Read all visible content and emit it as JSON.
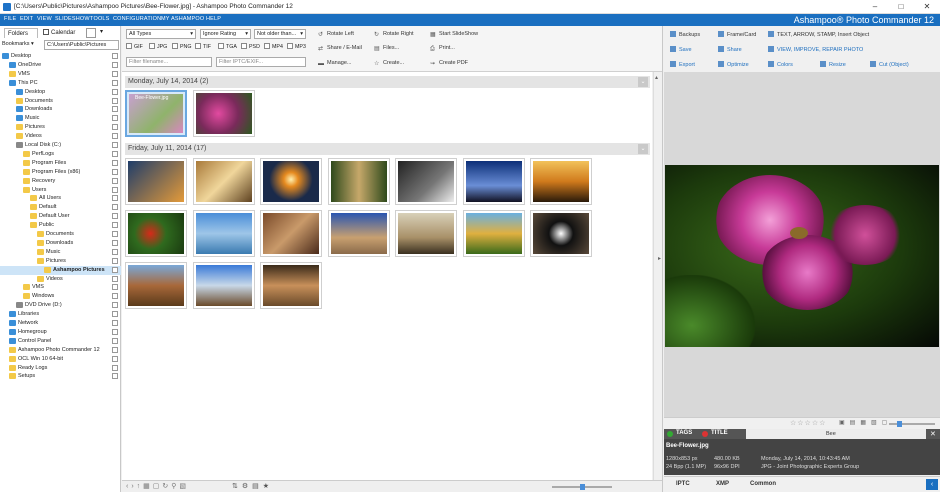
{
  "window": {
    "title": "[C:\\Users\\Public\\Pictures\\Ashampoo Pictures\\Bee-Flower.jpg] - Ashampoo Photo Commander 12",
    "brand": "Ashampoo® Photo Commander 12"
  },
  "menu": [
    "FILE",
    "EDIT",
    "VIEW",
    "SLIDESHOW",
    "TOOLS",
    "CONFIGURATION",
    "MY ASHAMPOO",
    "HELP"
  ],
  "left": {
    "tabs": {
      "folders": "Folders",
      "calendar": "Calendar"
    },
    "bookmarks": "Bookmarks",
    "path": "C:\\Users\\Public\\Pictures",
    "tree": [
      {
        "label": "Desktop",
        "indent": 0,
        "color": "#3a8fd8"
      },
      {
        "label": "OneDrive",
        "indent": 1,
        "color": "#3a8fd8"
      },
      {
        "label": "VMS",
        "indent": 1,
        "color": "#f3c948"
      },
      {
        "label": "This PC",
        "indent": 1,
        "color": "#3a8fd8"
      },
      {
        "label": "Desktop",
        "indent": 2,
        "color": "#3a8fd8"
      },
      {
        "label": "Documents",
        "indent": 2,
        "color": "#f3c948"
      },
      {
        "label": "Downloads",
        "indent": 2,
        "color": "#3a8fd8"
      },
      {
        "label": "Music",
        "indent": 2,
        "color": "#3a8fd8"
      },
      {
        "label": "Pictures",
        "indent": 2,
        "color": "#f3c948"
      },
      {
        "label": "Videos",
        "indent": 2,
        "color": "#f3c948"
      },
      {
        "label": "Local Disk (C:)",
        "indent": 2,
        "color": "#888888"
      },
      {
        "label": "PerfLogs",
        "indent": 3,
        "color": "#f3c948"
      },
      {
        "label": "Program Files",
        "indent": 3,
        "color": "#f3c948"
      },
      {
        "label": "Program Files (x86)",
        "indent": 3,
        "color": "#f3c948"
      },
      {
        "label": "Recovery",
        "indent": 3,
        "color": "#f3c948"
      },
      {
        "label": "Users",
        "indent": 3,
        "color": "#f3c948"
      },
      {
        "label": "All Users",
        "indent": 4,
        "color": "#f3c948"
      },
      {
        "label": "Default",
        "indent": 4,
        "color": "#f3c948"
      },
      {
        "label": "Default User",
        "indent": 4,
        "color": "#f3c948"
      },
      {
        "label": "Public",
        "indent": 4,
        "color": "#f3c948"
      },
      {
        "label": "Documents",
        "indent": 5,
        "color": "#f3c948"
      },
      {
        "label": "Downloads",
        "indent": 5,
        "color": "#f3c948"
      },
      {
        "label": "Music",
        "indent": 5,
        "color": "#f3c948"
      },
      {
        "label": "Pictures",
        "indent": 5,
        "color": "#f3c948"
      },
      {
        "label": "Ashampoo Pictures",
        "indent": 6,
        "color": "#f3c948",
        "selected": true
      },
      {
        "label": "Videos",
        "indent": 5,
        "color": "#f3c948"
      },
      {
        "label": "VMS",
        "indent": 3,
        "color": "#f3c948"
      },
      {
        "label": "Windows",
        "indent": 3,
        "color": "#f3c948"
      },
      {
        "label": "DVD Drive (D:)",
        "indent": 2,
        "color": "#888888"
      },
      {
        "label": "Libraries",
        "indent": 1,
        "color": "#3a8fd8"
      },
      {
        "label": "Network",
        "indent": 1,
        "color": "#3a8fd8"
      },
      {
        "label": "Homegroup",
        "indent": 1,
        "color": "#3a8fd8"
      },
      {
        "label": "Control Panel",
        "indent": 1,
        "color": "#3a8fd8"
      },
      {
        "label": "Ashampoo Photo Commander 12",
        "indent": 1,
        "color": "#f3c948"
      },
      {
        "label": "OCL Win 10 64-bit",
        "indent": 1,
        "color": "#f3c948"
      },
      {
        "label": "Ready Logs",
        "indent": 1,
        "color": "#f3c948"
      },
      {
        "label": "Setups",
        "indent": 1,
        "color": "#f3c948"
      }
    ]
  },
  "filters": {
    "type": "All Types",
    "rating": "Ignore Rating",
    "age": "Not older than...",
    "formats": [
      "GIF",
      "JPG",
      "PNG",
      "TIF",
      "TGA",
      "PSD",
      "MP4",
      "MP3"
    ],
    "filename_ph": "Filter filename...",
    "iptc_ph": "Filter IPTC/EXIF..."
  },
  "actions": {
    "rotate_left": "Rotate Left",
    "rotate_right": "Rotate Right",
    "slideshow": "Start SlideShow",
    "share_email": "Share / E-Mail",
    "files": "Files...",
    "print": "Print...",
    "manage": "Manage...",
    "create": "Create...",
    "create_pdf": "Create PDF"
  },
  "groups": [
    {
      "title": "Monday, July 14, 2014 (2)",
      "thumbs": [
        {
          "bg": "linear-gradient(135deg,#c8a0d0,#8fb36b 60%,#d987c0)",
          "label": "Bee-Flower.jpg",
          "selected": true
        },
        {
          "bg": "radial-gradient(circle at 40% 50%,#e24aa0,#7a2a5b 50%,#2c5a1f)"
        }
      ]
    },
    {
      "title": "Friday, July 11, 2014 (17)",
      "thumbs": [
        {
          "bg": "linear-gradient(135deg,#1f3d6a,#e39a3a)"
        },
        {
          "bg": "linear-gradient(135deg,#a97a3a,#f0d69b 50%,#5e4120)"
        },
        {
          "bg": "radial-gradient(circle at 50% 45%,#fff0b0,#e68a1f 20%,#1a2a4a 60%)"
        },
        {
          "bg": "linear-gradient(90deg,#2f4a1c,#c6a86a 50%,#2f4a1c)"
        },
        {
          "bg": "linear-gradient(135deg,#222,#777 60%,#eee)"
        },
        {
          "bg": "linear-gradient(180deg,#0c2f78,#6a8ed6 60%,#112)"
        },
        {
          "bg": "linear-gradient(180deg,#f2c25a,#d07a1c 50%,#2a1a0a)"
        },
        {
          "bg": "radial-gradient(circle at 40% 50%,#d62a1a,#2f6a1e 40%,#1a3a10)"
        },
        {
          "bg": "linear-gradient(180deg,#4a8ed8,#9ec6e8 50%,#3a7ab0)"
        },
        {
          "bg": "linear-gradient(135deg,#7a4a2a,#c99a6a 50%,#4a2a1a)"
        },
        {
          "bg": "linear-gradient(180deg,#2a56b0,#c8a070 60%,#8a6a4a)"
        },
        {
          "bg": "linear-gradient(180deg,#d8d0b8,#a89068 60%,#3a3020)"
        },
        {
          "bg": "linear-gradient(180deg,#6ab0e0,#e0b040 50%,#3a6a1a)"
        },
        {
          "bg": "radial-gradient(circle at 50% 50%,#fff,#111 35%,#5a4a3a)"
        },
        {
          "bg": "linear-gradient(180deg,#7aa8d8,#a8683a 50%,#5a3a1a)"
        },
        {
          "bg": "linear-gradient(180deg,#3a7ad8,#c8d8e8 50%,#6a4a2a)"
        },
        {
          "bg": "linear-gradient(180deg,#3a2a1a,#c8905a 50%,#6a4a2a)"
        }
      ]
    }
  ],
  "right": {
    "actions": [
      {
        "label": "Backups",
        "col": 0,
        "row": 0
      },
      {
        "label": "Frame/Card",
        "col": 1,
        "row": 0
      },
      {
        "label": "TEXT, ARROW, STAMP, Insert Object",
        "col": 2,
        "row": 0
      },
      {
        "label": "Save",
        "col": 0,
        "row": 1
      },
      {
        "label": "Share",
        "col": 1,
        "row": 1
      },
      {
        "label": "VIEW, IMPROVE, REPAIR PHOTO",
        "col": 2,
        "row": 1
      },
      {
        "label": "Export",
        "col": 0,
        "row": 2
      },
      {
        "label": "Optimize",
        "col": 1,
        "row": 2
      },
      {
        "label": "Colors",
        "col": 2,
        "row": 2
      },
      {
        "label": "Resize",
        "col": 3,
        "row": 2
      },
      {
        "label": "Cut (Object)",
        "col": 4,
        "row": 2
      }
    ],
    "name_label": "Bee",
    "tags": "TAGS",
    "title": "TITLE",
    "info": {
      "filename": "Bee-Flower.jpg",
      "dims": "1280x853 px",
      "size": "480.00 KB",
      "date": "Monday, July 14, 2014, 10:43:45 AM",
      "bpp": "24 Bpp (1.1 MP)",
      "dpi": "96x96 DPI",
      "format": "JPG - Joint Photographic Experts Group"
    },
    "tabs": [
      "IPTC",
      "XMP",
      "Common"
    ]
  },
  "colors": {
    "accent": "#1a6fc0"
  }
}
